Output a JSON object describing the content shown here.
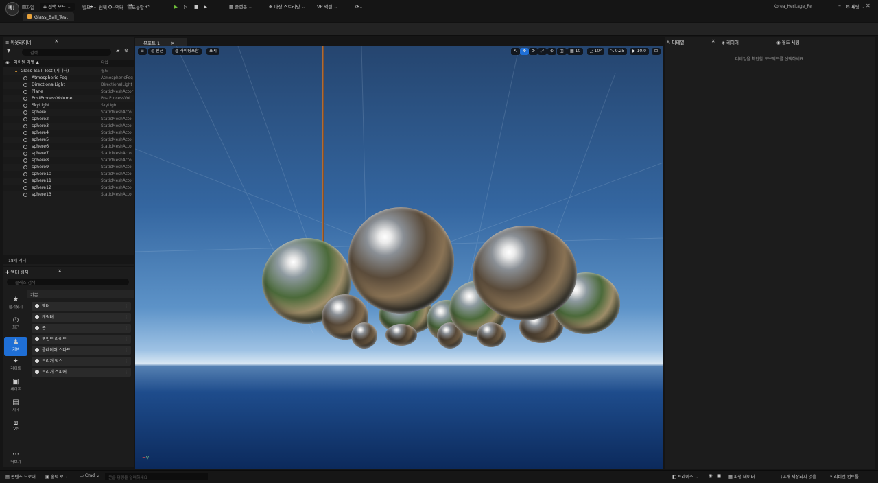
{
  "menubar": {
    "items": [
      "파일",
      "편집",
      "창",
      "툴",
      "빌드",
      "선택",
      "액터",
      "도움말"
    ],
    "document_tab": "Glass_Ball_Test",
    "project_name": "Korea_Heritage_Re"
  },
  "toolbar": {
    "mode_label": "선택 모드",
    "platforms_label": "플랫폼",
    "blueprint_label": "파생 스트리밍",
    "vp_label": "VP 액셀",
    "settings_label": "세팅"
  },
  "outliner": {
    "tab_label": "아웃라이너",
    "search_placeholder": "검색...",
    "col_label": "아이템 라벨 ▲",
    "col_type": "타입",
    "root_label": "Glass_Ball_Test (에디터)",
    "root_type": "월드",
    "items": [
      {
        "label": "Atmospheric Fog",
        "type": "AtmosphericFog"
      },
      {
        "label": "DirectionalLight",
        "type": "DirectionalLight"
      },
      {
        "label": "Plane",
        "type": "StaticMeshActor"
      },
      {
        "label": "PostProcessVolume",
        "type": "PostProcessVol"
      },
      {
        "label": "SkyLight",
        "type": "SkyLight"
      },
      {
        "label": "sphere",
        "type": "StaticMeshActo"
      },
      {
        "label": "sphere2",
        "type": "StaticMeshActo"
      },
      {
        "label": "sphere3",
        "type": "StaticMeshActo"
      },
      {
        "label": "sphere4",
        "type": "StaticMeshActo"
      },
      {
        "label": "sphere5",
        "type": "StaticMeshActo"
      },
      {
        "label": "sphere6",
        "type": "StaticMeshActo"
      },
      {
        "label": "sphere7",
        "type": "StaticMeshActo"
      },
      {
        "label": "sphere8",
        "type": "StaticMeshActo"
      },
      {
        "label": "sphere9",
        "type": "StaticMeshActo"
      },
      {
        "label": "sphere10",
        "type": "StaticMeshActo"
      },
      {
        "label": "sphere11",
        "type": "StaticMeshActo"
      },
      {
        "label": "sphere12",
        "type": "StaticMeshActo"
      },
      {
        "label": "sphere13",
        "type": "StaticMeshActo"
      }
    ],
    "actor_count": "18개 액터"
  },
  "place_actors": {
    "tab_label": "액터 배치",
    "search_placeholder": "클래스 검색",
    "section": "기본",
    "categories": [
      "즐겨찾기",
      "최근",
      "기본",
      "라이트",
      "셰이프",
      "시네",
      "VP",
      "더보기"
    ],
    "items": [
      "액터",
      "캐릭터",
      "폰",
      "포인트 라이트",
      "플레이어 스타트",
      "트리거 박스",
      "트리거 스피어"
    ]
  },
  "viewport": {
    "tab_label": "뷰포트 1",
    "perspective": "원근",
    "lit": "라이팅포함",
    "show": "표시",
    "grid_snap": "10",
    "rot_snap": "10°",
    "scale_snap": "0.25",
    "cam_speed": "10.0"
  },
  "details": {
    "tab_details": "디테일",
    "tab_layers": "레이어",
    "tab_world": "월드 세팅",
    "empty_msg": "디테일을 확인할 오브젝트를 선택하세요."
  },
  "statusbar": {
    "content_drawer": "콘텐츠 드로어",
    "output_log": "출력 로그",
    "cmd": "Cmd",
    "cmd_placeholder": "콘솔 명령을 입력하세요",
    "trace": "트레이스",
    "derived_data": "파생 데이터",
    "unsaved": "4개 저장되지 않음",
    "revision": "리비전 컨트롤"
  }
}
